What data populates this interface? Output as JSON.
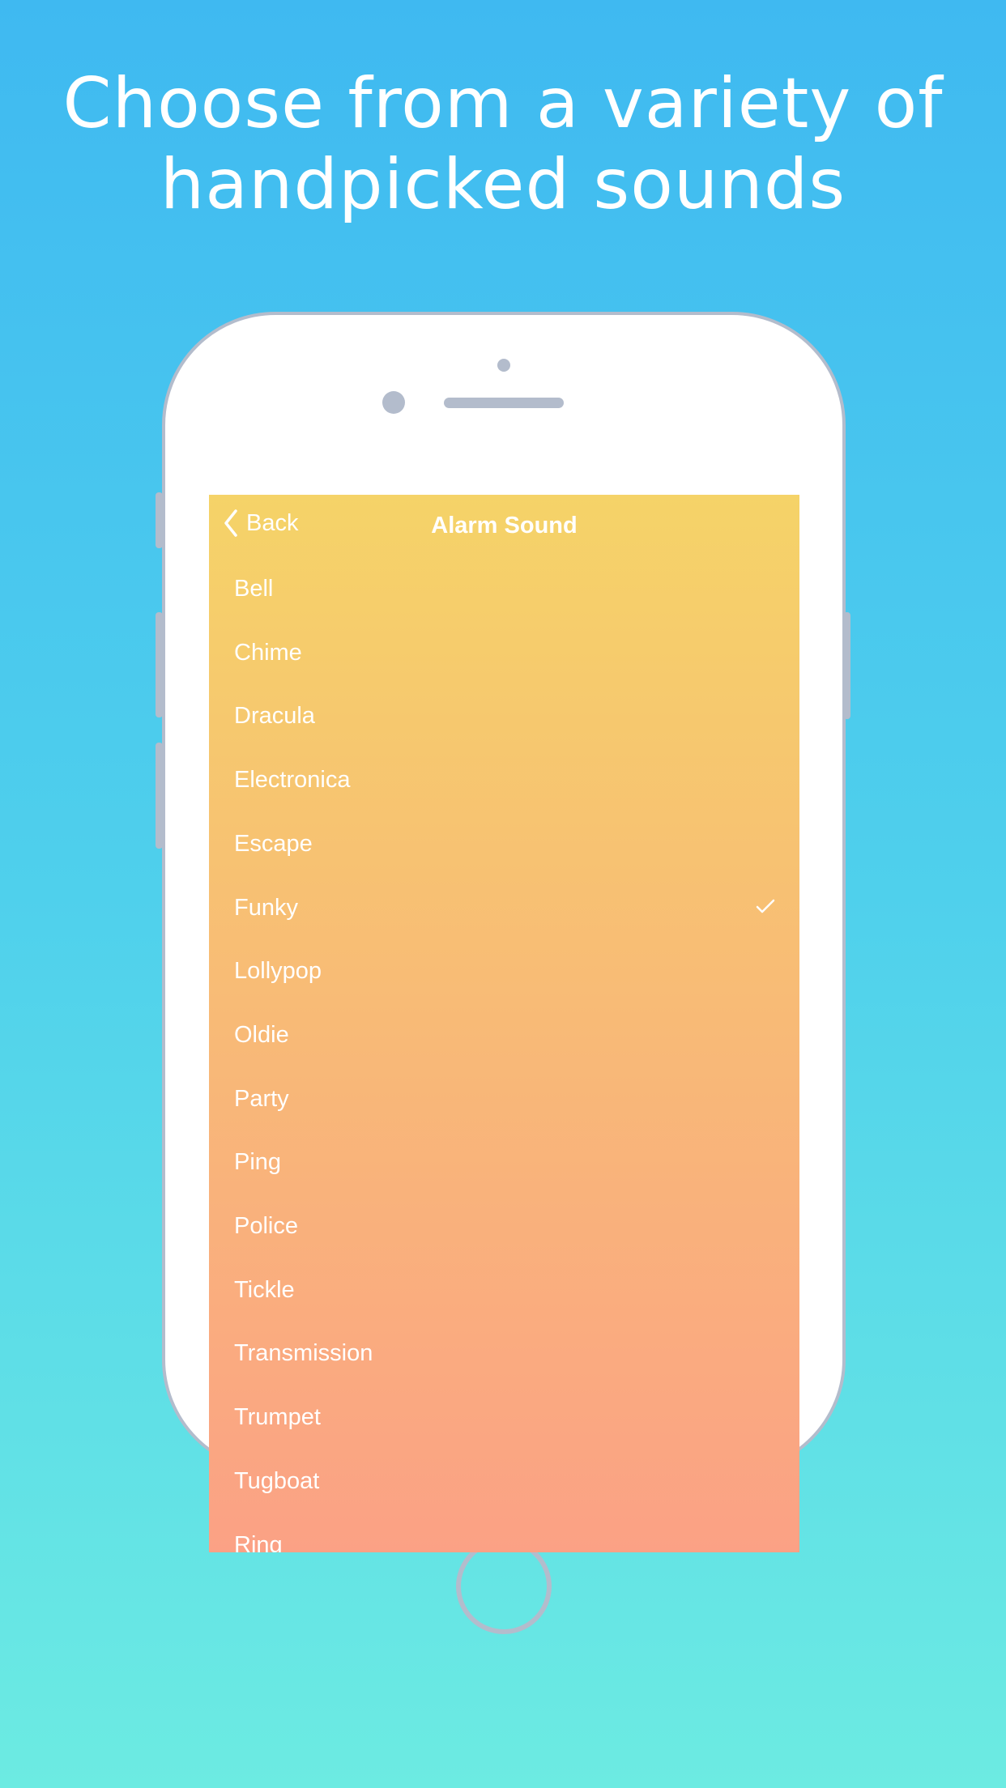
{
  "headline": {
    "line1": "Choose from a variety of",
    "line2": "handpicked sounds"
  },
  "screen": {
    "nav": {
      "back_label": "Back",
      "title": "Alarm Sound"
    },
    "sounds": [
      {
        "label": "Bell",
        "selected": false
      },
      {
        "label": "Chime",
        "selected": false
      },
      {
        "label": "Dracula",
        "selected": false
      },
      {
        "label": "Electronica",
        "selected": false
      },
      {
        "label": "Escape",
        "selected": false
      },
      {
        "label": "Funky",
        "selected": true
      },
      {
        "label": "Lollypop",
        "selected": false
      },
      {
        "label": "Oldie",
        "selected": false
      },
      {
        "label": "Party",
        "selected": false
      },
      {
        "label": "Ping",
        "selected": false
      },
      {
        "label": "Police",
        "selected": false
      },
      {
        "label": "Tickle",
        "selected": false
      },
      {
        "label": "Transmission",
        "selected": false
      },
      {
        "label": "Trumpet",
        "selected": false
      },
      {
        "label": "Tugboat",
        "selected": false
      },
      {
        "label": "Ring",
        "selected": false
      }
    ]
  },
  "colors": {
    "bg_top": "#3fb9f1",
    "bg_bottom": "#6cebe2",
    "screen_top": "#f5d368",
    "screen_bottom": "#fba185",
    "device_outline": "#b3bccc"
  }
}
